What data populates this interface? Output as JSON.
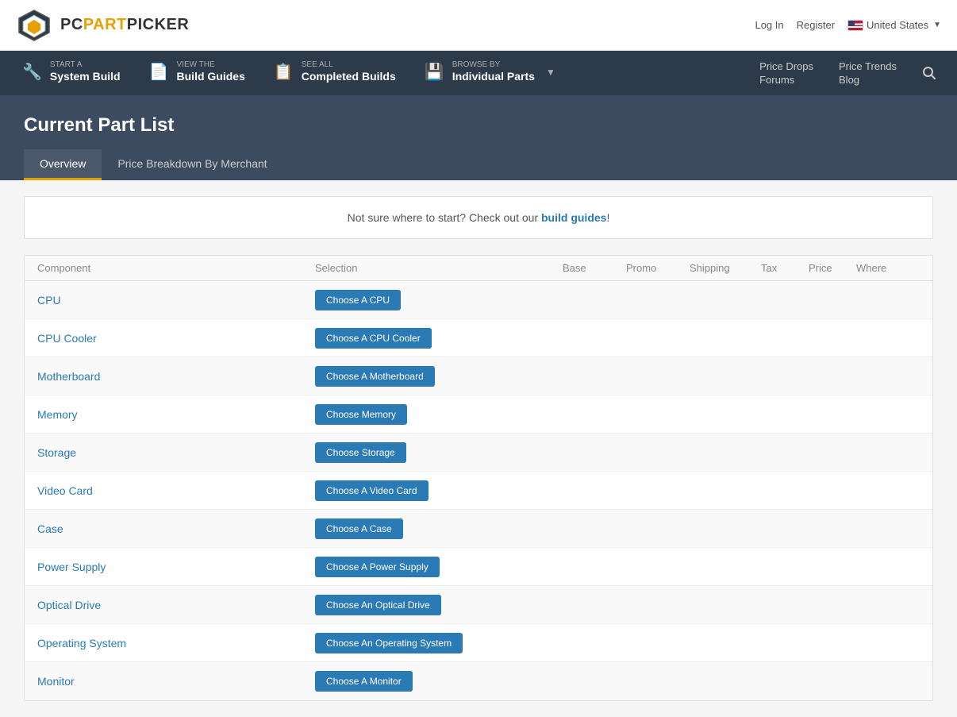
{
  "logo": {
    "pc": "PC",
    "part": "PART",
    "picker": "PICKER"
  },
  "header": {
    "login": "Log In",
    "register": "Register",
    "region": "United States"
  },
  "navbar": {
    "items": [
      {
        "id": "system-build",
        "sub": "START A",
        "main": "System Build"
      },
      {
        "id": "build-guides",
        "sub": "VIEW THE",
        "main": "Build Guides"
      },
      {
        "id": "completed-builds",
        "sub": "SEE ALL",
        "main": "Completed Builds"
      },
      {
        "id": "individual-parts",
        "sub": "BROWSE BY",
        "main": "Individual Parts"
      }
    ],
    "rightLinks": [
      {
        "id": "price-drops",
        "label": "Price Drops"
      },
      {
        "id": "price-trends",
        "label": "Price Trends"
      },
      {
        "id": "forums",
        "label": "Forums"
      },
      {
        "id": "blog",
        "label": "Blog"
      }
    ]
  },
  "page": {
    "title": "Current Part List",
    "tabs": [
      {
        "id": "overview",
        "label": "Overview",
        "active": true
      },
      {
        "id": "price-breakdown",
        "label": "Price Breakdown By Merchant",
        "active": false
      }
    ]
  },
  "infoBanner": {
    "text1": "Not sure where to start? Check out our ",
    "linkText": "build guides",
    "text2": "!"
  },
  "table": {
    "headers": [
      "Component",
      "Selection",
      "Base",
      "Promo",
      "Shipping",
      "Tax",
      "Price",
      "Where"
    ],
    "rows": [
      {
        "component": "CPU",
        "buttonLabel": "Choose A CPU"
      },
      {
        "component": "CPU Cooler",
        "buttonLabel": "Choose A CPU Cooler"
      },
      {
        "component": "Motherboard",
        "buttonLabel": "Choose A Motherboard"
      },
      {
        "component": "Memory",
        "buttonLabel": "Choose Memory"
      },
      {
        "component": "Storage",
        "buttonLabel": "Choose Storage"
      },
      {
        "component": "Video Card",
        "buttonLabel": "Choose A Video Card"
      },
      {
        "component": "Case",
        "buttonLabel": "Choose A Case"
      },
      {
        "component": "Power Supply",
        "buttonLabel": "Choose A Power Supply"
      },
      {
        "component": "Optical Drive",
        "buttonLabel": "Choose An Optical Drive"
      },
      {
        "component": "Operating System",
        "buttonLabel": "Choose An Operating System"
      },
      {
        "component": "Monitor",
        "buttonLabel": "Choose A Monitor"
      }
    ]
  }
}
